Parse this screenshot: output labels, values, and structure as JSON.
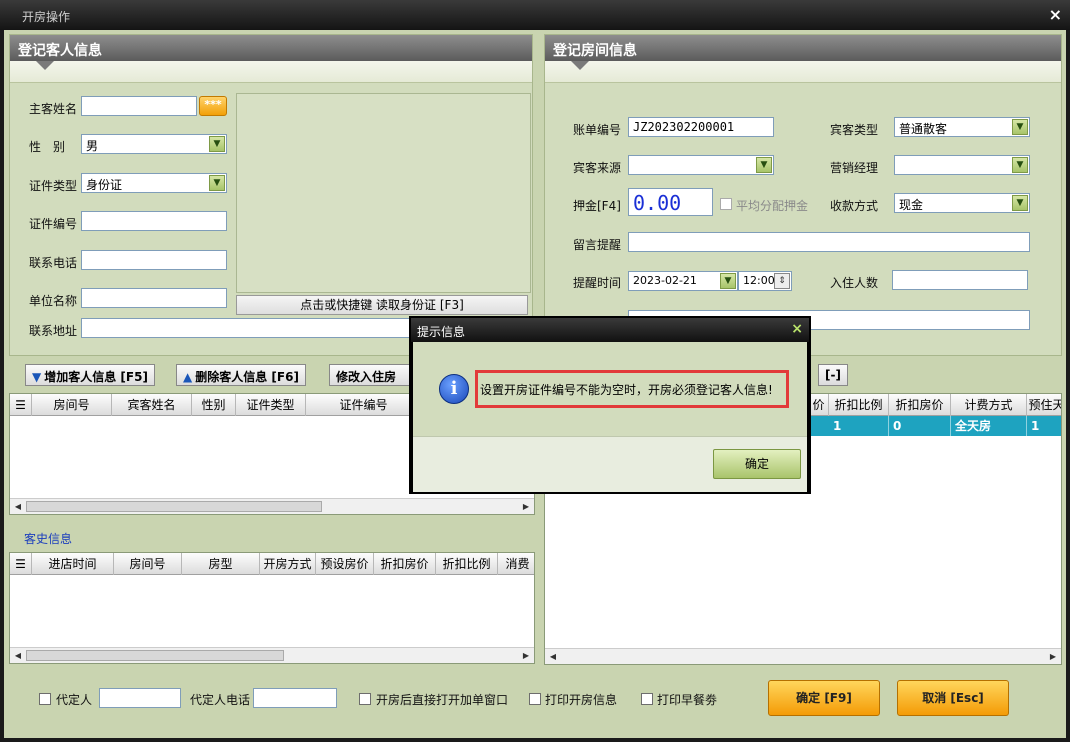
{
  "window": {
    "title": "开房操作",
    "close": "×"
  },
  "guest_panel": {
    "title": "登记客人信息",
    "fields": {
      "name_label": "主客姓名",
      "name_value": "",
      "star_btn": "***",
      "gender_label": "性　别",
      "gender_value": "男",
      "idtype_label": "证件类型",
      "idtype_value": "身份证",
      "idno_label": "证件编号",
      "idno_value": "",
      "phone_label": "联系电话",
      "phone_value": "",
      "company_label": "单位名称",
      "company_value": "",
      "address_label": "联系地址",
      "address_value": ""
    },
    "read_id_button": "点击或快捷键 读取身份证 [F3]"
  },
  "room_panel": {
    "title": "登记房间信息",
    "fields": {
      "bill_label": "账单编号",
      "bill_value": "JZ202302200001",
      "guest_type_label": "宾客类型",
      "guest_type_value": "普通散客",
      "source_label": "宾客来源",
      "source_value": "",
      "manager_label": "营销经理",
      "manager_value": "",
      "deposit_label": "押金[F4]",
      "deposit_value": "0.00",
      "split_label": "平均分配押金",
      "pay_label": "收款方式",
      "pay_value": "现金",
      "note_label": "留言提醒",
      "note_value": "",
      "remind_label": "提醒时间",
      "remind_date": "2023-02-21",
      "remind_time": "12:00",
      "persons_label": "入住人数",
      "persons_value": ""
    }
  },
  "toolbar": {
    "add_guest": "增加客人信息 [F5]",
    "del_guest": "删除客人信息 [F6]",
    "modify": "修改入住房",
    "minus": "[-]"
  },
  "guest_grid": {
    "headers": [
      "房间号",
      "宾客姓名",
      "性别",
      "证件类型",
      "证件编号"
    ]
  },
  "room_grid": {
    "headers": [
      "价",
      "折扣比例",
      "折扣房价",
      "计费方式",
      "预住天"
    ],
    "row": [
      "1",
      "0",
      "全天房",
      "1"
    ]
  },
  "history": {
    "title": "客史信息",
    "headers": [
      "进店时间",
      "房间号",
      "房型",
      "开房方式",
      "预设房价",
      "折扣房价",
      "折扣比例",
      "消费"
    ]
  },
  "bottom": {
    "agent_label": "代定人",
    "agent_phone_label": "代定人电话",
    "open_bill_label": "开房后直接打开加单窗口",
    "print_open_label": "打印开房信息",
    "print_breakfast_label": "打印早餐劵",
    "confirm_btn": "确定 [F9]",
    "cancel_btn": "取消 [Esc]"
  },
  "dialog": {
    "title": "提示信息",
    "close": "×",
    "icon": "i",
    "message": "设置开房证件编号不能为空时，开房必须登记客人信息!",
    "ok": "确定"
  }
}
